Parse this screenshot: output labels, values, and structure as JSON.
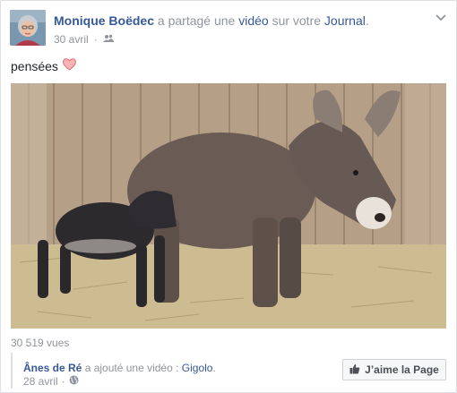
{
  "post": {
    "author": "Monique Boëdec",
    "shared_text": "a partagé une",
    "shared_link": "vidéo",
    "on_text": "sur votre",
    "target_link": "Journal",
    "punct": ".",
    "date": "30 avril",
    "audience_icon": "friends-icon",
    "caption": "pensées",
    "caption_icon": "heart-icon",
    "views": "30 519 vues"
  },
  "attribution": {
    "page_name": "Ânes de Ré",
    "action_text": "a ajouté une vidéo :",
    "video_title": "Gigolo",
    "punct": ".",
    "date": "28 avril",
    "audience_icon": "globe-icon",
    "like_button": "J’aime la Page",
    "like_icon": "thumbs-up-icon"
  },
  "colors": {
    "link": "#365899",
    "muted": "#90949c",
    "heart": "#f28b8b"
  }
}
